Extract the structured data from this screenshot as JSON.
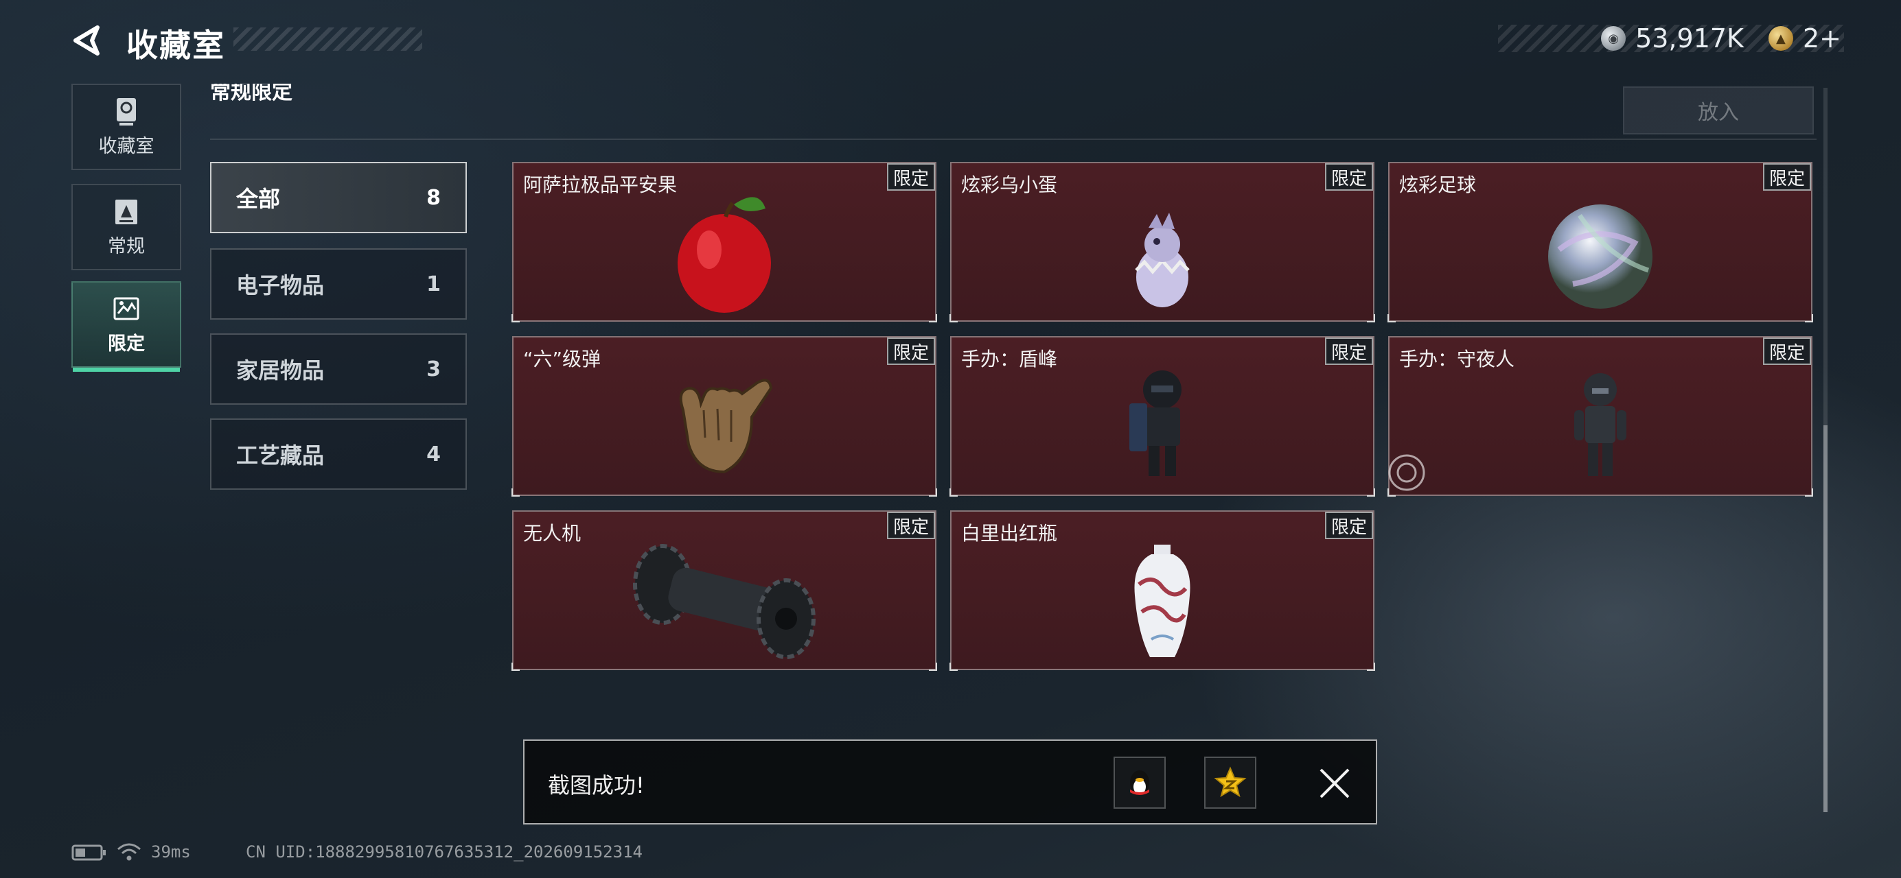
{
  "header": {
    "title": "收藏室",
    "silver_amount": "53,917K",
    "gold_amount": "2+"
  },
  "sidebar": {
    "items": [
      {
        "label": "收藏室",
        "icon": "trophy-icon"
      },
      {
        "label": "常规",
        "icon": "document-icon"
      },
      {
        "label": "限定",
        "icon": "picture-icon",
        "active": true
      }
    ]
  },
  "section": {
    "title": "常规限定",
    "place_button": "放入"
  },
  "categories": [
    {
      "label": "全部",
      "count": "8",
      "active": true
    },
    {
      "label": "电子物品",
      "count": "1"
    },
    {
      "label": "家居物品",
      "count": "3"
    },
    {
      "label": "工艺藏品",
      "count": "4"
    }
  ],
  "items": [
    {
      "name": "阿萨拉极品平安果",
      "tag": "限定",
      "icon": "apple-icon"
    },
    {
      "name": "炫彩乌小蛋",
      "tag": "限定",
      "icon": "egg-figure-icon"
    },
    {
      "name": "炫彩足球",
      "tag": "限定",
      "icon": "iridescent-ball-icon"
    },
    {
      "name": "“六”级弹",
      "tag": "限定",
      "icon": "hand-sign-icon"
    },
    {
      "name": "手办：盾峰",
      "tag": "限定",
      "icon": "soldier-figure-icon"
    },
    {
      "name": "手办：守夜人",
      "tag": "限定",
      "icon": "soldier-figure-icon"
    },
    {
      "name": "无人机",
      "tag": "限定",
      "icon": "drone-icon"
    },
    {
      "name": "白里出红瓶",
      "tag": "限定",
      "icon": "vase-icon"
    }
  ],
  "toast": {
    "message": "截图成功!",
    "share_qq_icon": "qq-penguin-icon",
    "share_qzone_icon": "qzone-star-icon"
  },
  "statusbar": {
    "ping": "39ms",
    "uid": "CN UID:18882995810767635312_202609152314"
  },
  "colors": {
    "card_bg": "#4b1e24",
    "active_accent": "#4fd3a6"
  }
}
